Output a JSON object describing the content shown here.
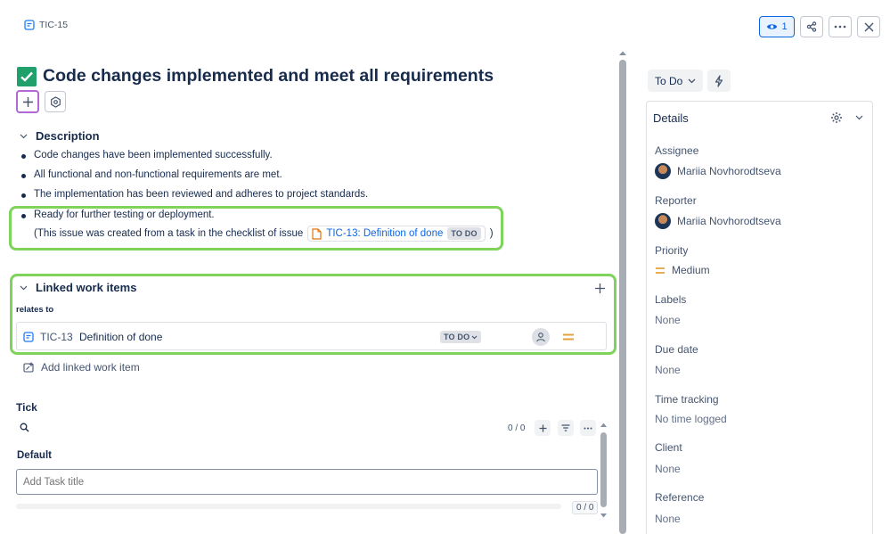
{
  "header": {
    "issue_key": "TIC-15",
    "watch_count": "1"
  },
  "issue": {
    "title": "Code changes implemented and meet all requirements"
  },
  "description": {
    "heading": "Description",
    "items": [
      "Code changes have been implemented successfully.",
      "All functional and non-functional requirements are met.",
      "The implementation has been reviewed and adheres to project standards.",
      "Ready for further testing or deployment."
    ],
    "note_prefix": "(This issue was created from a task in the checklist of issue",
    "note_link": "TIC-13: Definition of done",
    "note_status": "TO DO",
    "note_suffix": ")"
  },
  "linked": {
    "heading": "Linked work items",
    "relation": "relates to",
    "item_key": "TIC-13",
    "item_title": "Definition of done",
    "item_status": "TO DO",
    "add_label": "Add linked work item"
  },
  "tick": {
    "heading": "Tick",
    "count": "0 / 0",
    "group": "Default",
    "input_placeholder": "Add Task title",
    "progress": "0 / 0",
    "progress_fraction": 0
  },
  "sidebar": {
    "status": "To Do",
    "details_heading": "Details",
    "fields": {
      "assignee_label": "Assignee",
      "assignee_value": "Mariia Novhorodtseva",
      "reporter_label": "Reporter",
      "reporter_value": "Mariia Novhorodtseva",
      "priority_label": "Priority",
      "priority_value": "Medium",
      "labels_label": "Labels",
      "labels_value": "None",
      "due_label": "Due date",
      "due_value": "None",
      "time_label": "Time tracking",
      "time_value": "No time logged",
      "client_label": "Client",
      "client_value": "None",
      "reference_label": "Reference",
      "reference_value": "None"
    }
  },
  "colors": {
    "highlight_green": "#7fd35a",
    "highlight_purple": "#b069d6",
    "link_blue": "#0c66e4",
    "priority_orange": "#e2a03f",
    "done_green": "#22a06b"
  }
}
